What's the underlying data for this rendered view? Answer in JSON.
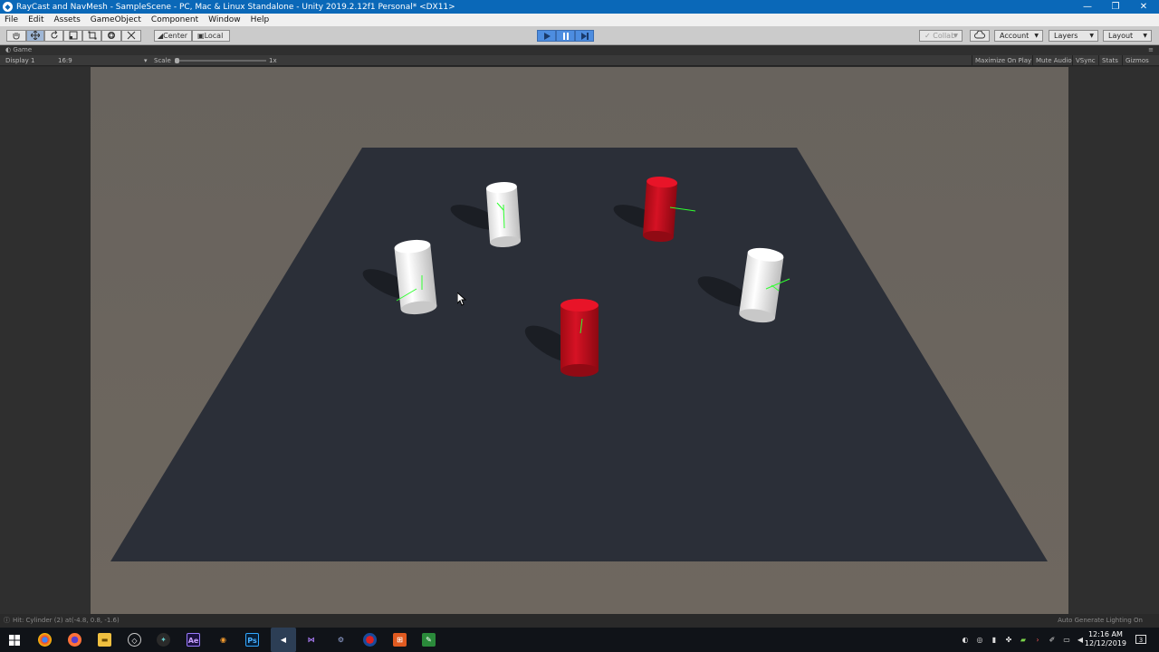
{
  "window": {
    "title": "RayCast and NavMesh - SampleScene - PC, Mac & Linux Standalone - Unity 2019.2.12f1 Personal* <DX11>",
    "minimize": "—",
    "maximize": "❐",
    "close": "✕"
  },
  "menu": [
    "File",
    "Edit",
    "Assets",
    "GameObject",
    "Component",
    "Window",
    "Help"
  ],
  "toolbar": {
    "pivot_label": "Center",
    "space_label": "Local",
    "collab_label": "Collab",
    "account_label": "Account",
    "layers_label": "Layers",
    "layout_label": "Layout"
  },
  "game_tab": {
    "label": "Game"
  },
  "game_bar": {
    "display": "Display 1",
    "aspect": "16:9",
    "scale_label": "Scale",
    "scale_value": "1x",
    "maximize_on_play": "Maximize On Play",
    "mute_audio": "Mute Audio",
    "vsync": "VSync",
    "stats": "Stats",
    "gizmos": "Gizmos"
  },
  "status": {
    "message": "Hit: Cylinder (2) at(-4.8, 0.8, -1.6)",
    "lighting": "Auto Generate Lighting On"
  },
  "taskbar": {
    "time": "12:16 AM",
    "date": "12/12/2019",
    "notification_count": "3"
  },
  "scene": {
    "plane_color": "#2b2f38",
    "white_cylinder_color": "#f2f2f2",
    "red_cylinder_color": "#cc1020",
    "gizmo_color": "#30ff30"
  }
}
